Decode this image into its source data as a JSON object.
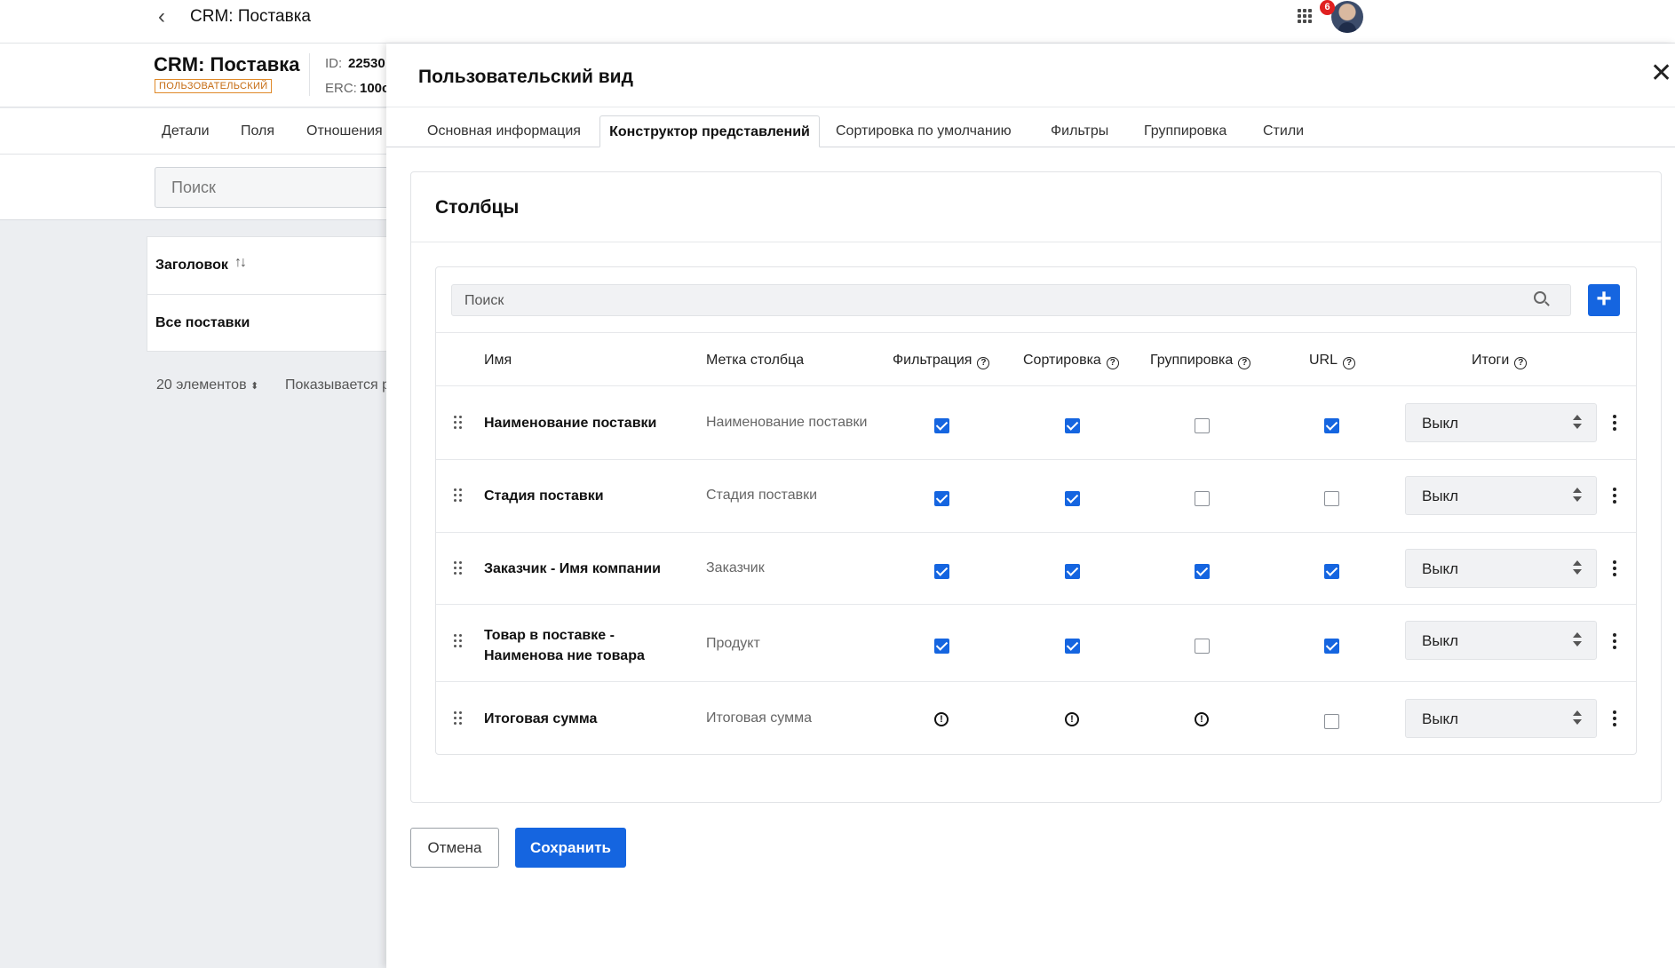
{
  "app": {
    "title": "CRM: Поставка",
    "notifications": "6"
  },
  "background": {
    "title": "CRM: Поставка",
    "badge": "ПОЛЬЗОВАТЕЛЬСКИЙ",
    "id_label": "ID:",
    "id_value": "22530",
    "erc_label": "ERC:",
    "erc_value": "100c",
    "tabs": [
      "Детали",
      "Поля",
      "Отношения"
    ],
    "search_placeholder": "Поиск",
    "table_header": "Заголовок",
    "table_row": "Все поставки",
    "count": "20 элементов",
    "shown": "Показывается р"
  },
  "drawer": {
    "title": "Пользовательский вид",
    "tabs": [
      "Основная информация",
      "Конструктор представлений",
      "Сортировка по умолчанию",
      "Фильтры",
      "Группировка",
      "Стили"
    ],
    "active_tab": "Конструктор представлений",
    "section_title": "Столбцы",
    "search_placeholder": "Поиск",
    "columns_header": {
      "name": "Имя",
      "label": "Метка столбца",
      "filter": "Фильтрация",
      "sort": "Сортировка",
      "group": "Группировка",
      "url": "URL",
      "totals": "Итоги"
    },
    "rows": [
      {
        "name": "Наименование поставки",
        "label": "Наименование поставки",
        "filter": "on",
        "sort": "on",
        "group": "off",
        "url": "on",
        "totals": "Выкл"
      },
      {
        "name": "Стадия поставки",
        "label": "Стадия поставки",
        "filter": "on",
        "sort": "on",
        "group": "off",
        "url": "off",
        "totals": "Выкл"
      },
      {
        "name": "Заказчик - Имя компании",
        "label": "Заказчик",
        "filter": "on",
        "sort": "on",
        "group": "on",
        "url": "on",
        "totals": "Выкл"
      },
      {
        "name": "Товар в поставке - Наименова ние товара",
        "label": "Продукт",
        "filter": "on",
        "sort": "on",
        "group": "off",
        "url": "on",
        "totals": "Выкл"
      },
      {
        "name": "Итоговая сумма",
        "label": "Итоговая сумма",
        "filter": "warning",
        "sort": "warning",
        "group": "warning",
        "url": "off",
        "totals": "Выкл"
      }
    ],
    "cancel_label": "Отмена",
    "save_label": "Сохранить",
    "accent_color": "#1565e0"
  }
}
